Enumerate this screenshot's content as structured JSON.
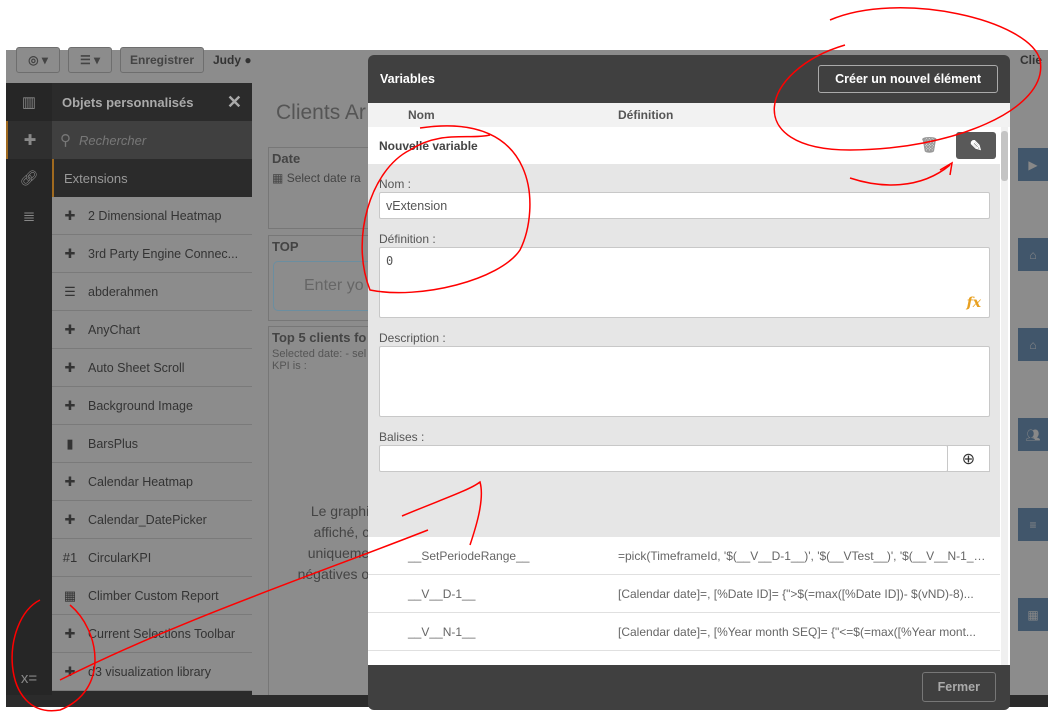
{
  "toolbar": {
    "save_label": "Enregistrer",
    "user": "Judy",
    "client_label": "Clie"
  },
  "panel": {
    "title": "Objets personnalisés",
    "search_placeholder": "Rechercher",
    "category": "Extensions",
    "items": [
      {
        "label": "2 Dimensional Heatmap",
        "icon": "puzzle-icon"
      },
      {
        "label": "3rd Party Engine Connec...",
        "icon": "puzzle-icon"
      },
      {
        "label": "abderahmen",
        "icon": "bars-horizontal-icon"
      },
      {
        "label": "AnyChart",
        "icon": "puzzle-icon"
      },
      {
        "label": "Auto Sheet Scroll",
        "icon": "puzzle-icon"
      },
      {
        "label": "Background Image",
        "icon": "puzzle-icon"
      },
      {
        "label": "BarsPlus",
        "icon": "bar-chart-icon"
      },
      {
        "label": "Calendar Heatmap",
        "icon": "puzzle-icon"
      },
      {
        "label": "Calendar_DatePicker",
        "icon": "puzzle-icon"
      },
      {
        "label": "CircularKPI",
        "icon": "kpi-icon"
      },
      {
        "label": "Climber Custom Report",
        "icon": "table-icon"
      },
      {
        "label": "Current Selections Toolbar",
        "icon": "puzzle-icon"
      },
      {
        "label": "d3 visualization library",
        "icon": "puzzle-icon"
      }
    ]
  },
  "sheet": {
    "title": "Clients Ar",
    "date_title": "Date",
    "date_text": "Select date ra",
    "top_title": "TOP",
    "top_input": "Enter yo",
    "chart_title": "Top 5 clients fo",
    "chart_sub1": "Selected date: - sel",
    "chart_sub2": "KPI is :",
    "msg": [
      "Le graphiq",
      "affiché, ca",
      "uniquemen",
      "négatives ou"
    ]
  },
  "modal": {
    "title": "Variables",
    "new_button": "Créer un nouvel élément",
    "col_name": "Nom",
    "col_def": "Définition",
    "edit": {
      "header": "Nouvelle variable",
      "name_label": "Nom :",
      "name_value": "vExtension",
      "def_label": "Définition :",
      "def_value": "0",
      "desc_label": "Description :",
      "desc_value": "",
      "tags_label": "Balises :",
      "tags_value": ""
    },
    "rows": [
      {
        "name": "__SetPeriodeRange__",
        "def": "=pick(TimeframeId, '$(__V__D-1__)', '$(__VTest__)', '$(__V__N-1__)'..."
      },
      {
        "name": "__V__D-1__",
        "def": "[Calendar date]=, [%Date ID]= {\">$(=max([%Date ID])- $(vND)-8)..."
      },
      {
        "name": "__V__N-1__",
        "def": "[Calendar date]=, [%Year month SEQ]= {\"<=$(=max([%Year mont..."
      }
    ],
    "close_button": "Fermer"
  },
  "colors": {
    "accent": "#a06a1f",
    "modal_dark": "#404040",
    "fx": "#e8a020",
    "annotation": "#ff0000"
  }
}
